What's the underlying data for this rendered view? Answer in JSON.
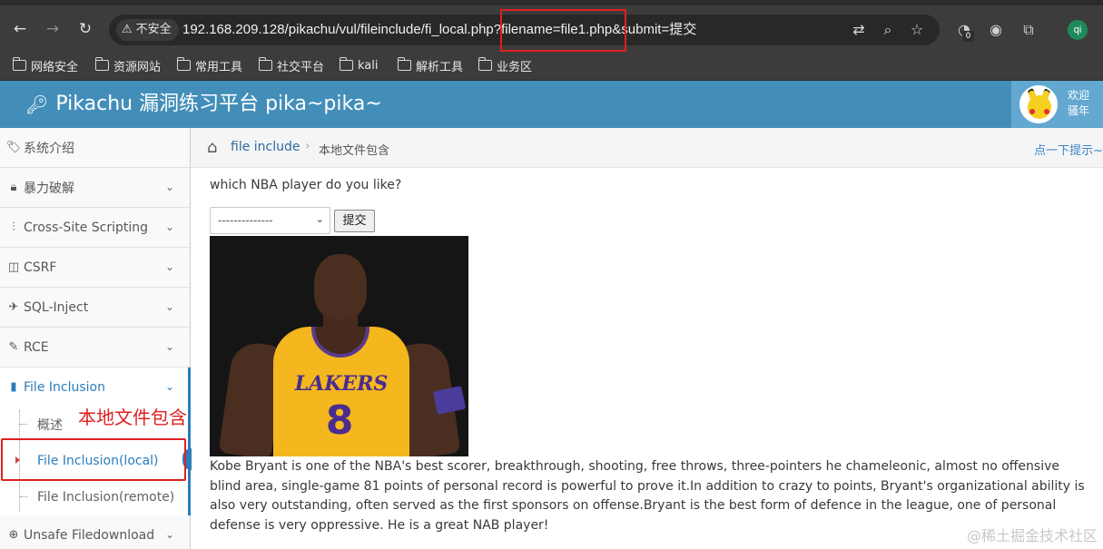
{
  "browser": {
    "nav": {
      "back": "←",
      "forward": "→",
      "reload": "↻"
    },
    "security_label": "不安全",
    "url": "192.168.209.128/pikachu/vul/fileinclude/fi_local.php?filename=file1.php&submit=提交",
    "extension_badge": "0",
    "profile_initials": "qi",
    "bookmarks": [
      "网络安全",
      "资源网站",
      "常用工具",
      "社交平台",
      "kali",
      "解析工具",
      "业务区"
    ]
  },
  "app": {
    "title": "Pikachu 漏洞练习平台 pika~pika~",
    "user_line1": "欢迎",
    "user_line2": "骚年",
    "accent": "#438eb9"
  },
  "sidebar": {
    "items": [
      {
        "label": "系统介绍",
        "icon": "tags-icon"
      },
      {
        "label": "暴力破解",
        "icon": "lock-icon"
      },
      {
        "label": "Cross-Site Scripting",
        "icon": "sliders-icon"
      },
      {
        "label": "CSRF",
        "icon": "caret-square-icon"
      },
      {
        "label": "SQL-Inject",
        "icon": "plane-icon"
      },
      {
        "label": "RCE",
        "icon": "pencil-icon"
      },
      {
        "label": "File Inclusion",
        "icon": "file-icon"
      },
      {
        "label": "Unsafe Filedownload",
        "icon": "download-icon"
      }
    ],
    "sub_items": [
      {
        "label": "概述"
      },
      {
        "label": "File Inclusion(local)"
      },
      {
        "label": "File Inclusion(remote)"
      }
    ]
  },
  "annotation": {
    "label": "本地文件包含"
  },
  "breadcrumb": {
    "link": "file include",
    "separator": "›",
    "current": "本地文件包含",
    "hint": "点一下提示~"
  },
  "main": {
    "question": "which NBA player do you like?",
    "select_value": "--------------",
    "submit_label": "提交",
    "photo": {
      "jersey_logo": "LAKERS",
      "jersey_number": "8"
    },
    "description": "Kobe Bryant is one of the NBA's best scorer, breakthrough, shooting, free throws, three-pointers he chameleonic, almost no offensive blind area, single-game 81 points of personal record is powerful to prove it.In addition to crazy to points, Bryant's organizational ability is also very outstanding, often served as the first sponsors on offense.Bryant is the best form of defence in the league, one of personal defense is very oppressive. He is a great NAB player!"
  },
  "watermark": "@稀土掘金技术社区"
}
